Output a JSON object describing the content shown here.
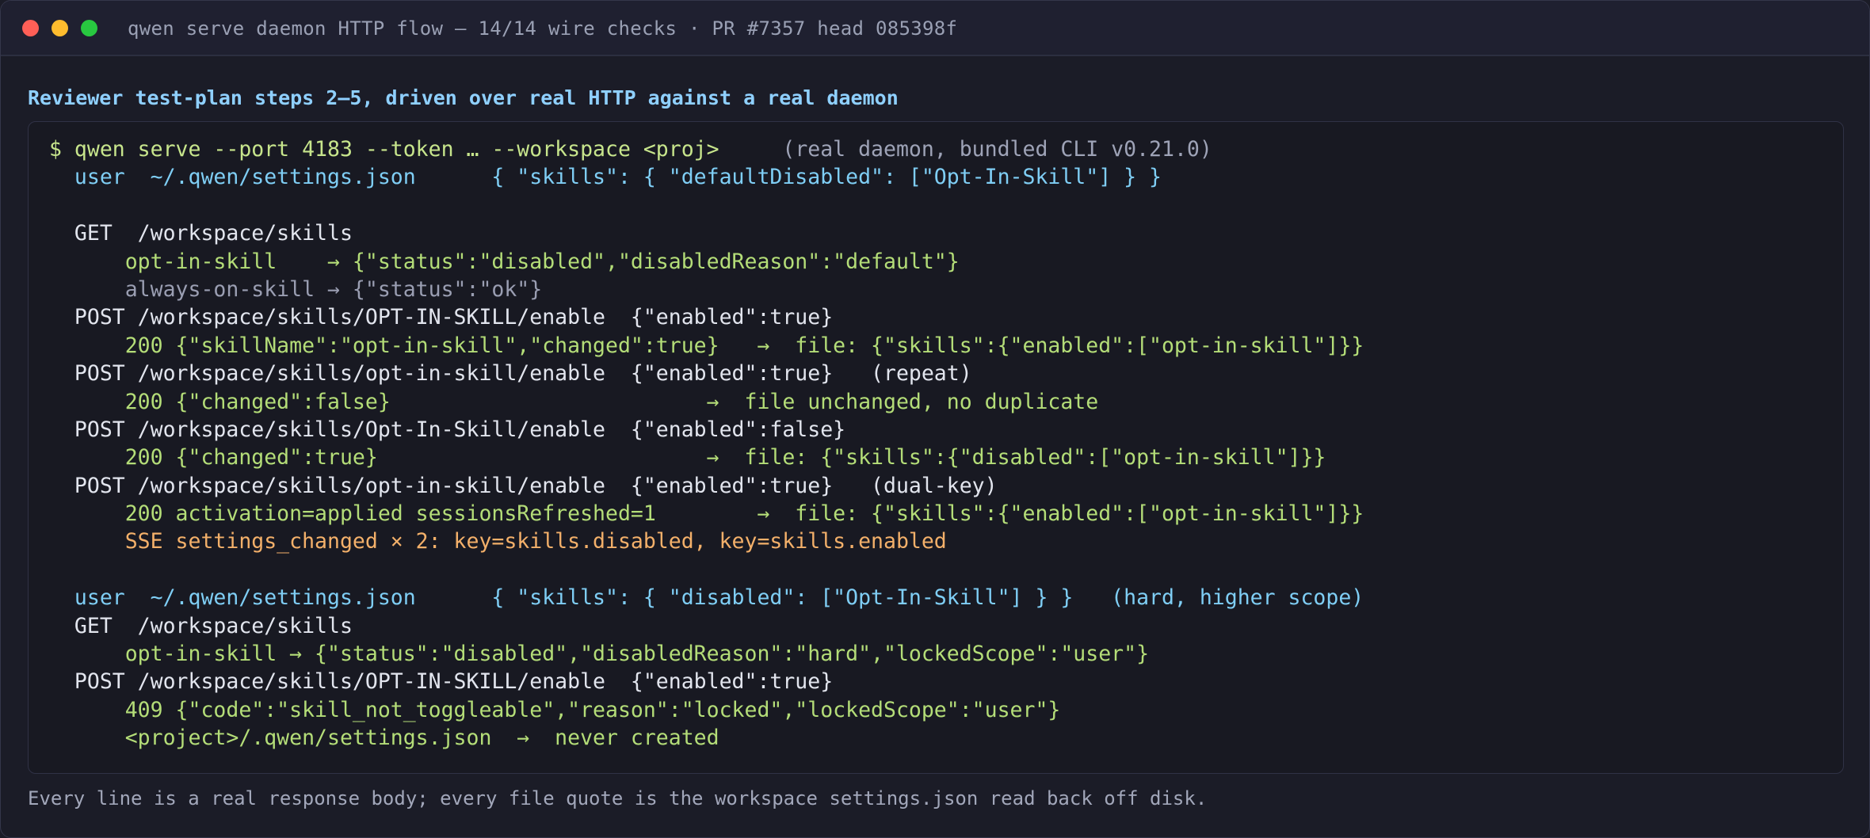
{
  "window": {
    "title": "qwen serve daemon HTTP flow — 14/14 wire checks · PR #7357 head 085398f"
  },
  "heading": "Reviewer test-plan steps 2–5, driven over real HTTP against a real daemon",
  "terminal_lines": [
    {
      "segs": [
        {
          "text": "$ qwen serve --port 4183 --token … --workspace <proj>",
          "c": "prompt"
        },
        {
          "text": "     (real daemon, bundled CLI v0.21.0)",
          "c": "muted"
        }
      ]
    },
    {
      "segs": [
        {
          "text": "  user  ~/.qwen/settings.json      { \"skills\": { \"defaultDisabled\": [\"Opt-In-Skill\"] } }",
          "c": "user"
        }
      ]
    },
    {
      "segs": []
    },
    {
      "segs": [
        {
          "text": "  GET  /workspace/skills",
          "c": "white"
        }
      ]
    },
    {
      "segs": [
        {
          "text": "      opt-in-skill    → {\"status\":\"disabled\",\"disabledReason\":\"default\"}",
          "c": "green"
        }
      ]
    },
    {
      "segs": [
        {
          "text": "      always-on-skill → {\"status\":\"ok\"}",
          "c": "gray"
        }
      ]
    },
    {
      "segs": [
        {
          "text": "  POST /workspace/skills/OPT-IN-SKILL/enable  {\"enabled\":true}",
          "c": "white"
        }
      ]
    },
    {
      "segs": [
        {
          "text": "      200 {\"skillName\":\"opt-in-skill\",\"changed\":true}   →  file: {\"skills\":{\"enabled\":[\"opt-in-skill\"]}}",
          "c": "green"
        }
      ]
    },
    {
      "segs": [
        {
          "text": "  POST /workspace/skills/opt-in-skill/enable  {\"enabled\":true}   (repeat)",
          "c": "white"
        }
      ]
    },
    {
      "segs": [
        {
          "text": "      200 {\"changed\":false}                         →  file unchanged, no duplicate",
          "c": "green"
        }
      ]
    },
    {
      "segs": [
        {
          "text": "  POST /workspace/skills/Opt-In-Skill/enable  {\"enabled\":false}",
          "c": "white"
        }
      ]
    },
    {
      "segs": [
        {
          "text": "      200 {\"changed\":true}                          →  file: {\"skills\":{\"disabled\":[\"opt-in-skill\"]}}",
          "c": "green"
        }
      ]
    },
    {
      "segs": [
        {
          "text": "  POST /workspace/skills/opt-in-skill/enable  {\"enabled\":true}   (dual-key)",
          "c": "white"
        }
      ]
    },
    {
      "segs": [
        {
          "text": "      200 activation=applied sessionsRefreshed=1        →  file: {\"skills\":{\"enabled\":[\"opt-in-skill\"]}}",
          "c": "green"
        }
      ]
    },
    {
      "segs": [
        {
          "text": "      SSE settings_changed × 2: key=skills.disabled, key=skills.enabled",
          "c": "orange"
        }
      ]
    },
    {
      "segs": []
    },
    {
      "segs": [
        {
          "text": "  user  ~/.qwen/settings.json      { \"skills\": { \"disabled\": [\"Opt-In-Skill\"] } }   (hard, higher scope)",
          "c": "user"
        }
      ]
    },
    {
      "segs": [
        {
          "text": "  GET  /workspace/skills",
          "c": "white"
        }
      ]
    },
    {
      "segs": [
        {
          "text": "      opt-in-skill → {\"status\":\"disabled\",\"disabledReason\":\"hard\",\"lockedScope\":\"user\"}",
          "c": "green"
        }
      ]
    },
    {
      "segs": [
        {
          "text": "  POST /workspace/skills/OPT-IN-SKILL/enable  {\"enabled\":true}",
          "c": "white"
        }
      ]
    },
    {
      "segs": [
        {
          "text": "      409 {\"code\":\"skill_not_toggleable\",\"reason\":\"locked\",\"lockedScope\":\"user\"}",
          "c": "green"
        }
      ]
    },
    {
      "segs": [
        {
          "text": "      <project>/.qwen/settings.json  →  never created",
          "c": "green"
        }
      ]
    }
  ],
  "footer": "Every line is a real response body; every file quote is the workspace settings.json read back off disk.",
  "colors": {
    "prompt": "#c7e58c",
    "user": "#7fcef5",
    "green": "#b4dd78",
    "orange": "#f3b06a",
    "heading": "#8fd0ff"
  }
}
